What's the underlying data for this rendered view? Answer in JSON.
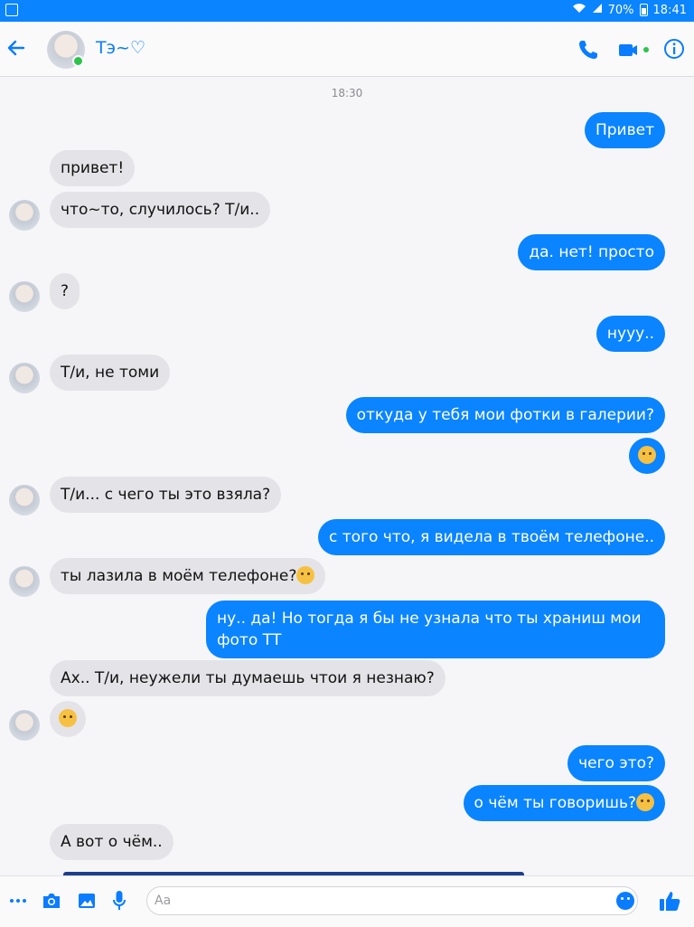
{
  "status_bar": {
    "battery": "70%",
    "time": "18:41"
  },
  "header": {
    "contact_name": "Тэ~♡"
  },
  "thread": {
    "timestamp": "18:30",
    "messages": [
      {
        "dir": "out",
        "text": "Привет"
      },
      {
        "dir": "in",
        "text": "привет!"
      },
      {
        "dir": "in",
        "text": "что~то, случилось? Т/и.."
      },
      {
        "dir": "out",
        "text": "да. нет! просто"
      },
      {
        "dir": "in",
        "text": "?"
      },
      {
        "dir": "out",
        "text": "нууу.."
      },
      {
        "dir": "in",
        "text": "Т/и, не томи"
      },
      {
        "dir": "out",
        "text": "откуда у тебя мои фотки в галерии?"
      },
      {
        "dir": "out",
        "text": ""
      },
      {
        "dir": "in",
        "text": "Т/и... с чего ты это взяла?"
      },
      {
        "dir": "out",
        "text": "с того что, я видела в твоём телефоне.."
      },
      {
        "dir": "in",
        "text": "ты лазила в моём телефоне?"
      },
      {
        "dir": "out",
        "text": "ну.. да! Но тогда я бы не узнала что ты храниш мои фото ТТ"
      },
      {
        "dir": "in",
        "text": "Ах.. Т/и, неужели ты думаешь чтои я  незнаю?"
      },
      {
        "dir": "in",
        "text": ""
      },
      {
        "dir": "out",
        "text": "чего это?"
      },
      {
        "dir": "out",
        "text": "о чём ты говоришь?"
      },
      {
        "dir": "in",
        "text": "А вот о чём.."
      }
    ]
  },
  "composer": {
    "placeholder": "Aa"
  },
  "colors": {
    "accent": "#0a84ff",
    "incoming_bubble": "#e4e4e8",
    "online": "#2ec34d"
  }
}
